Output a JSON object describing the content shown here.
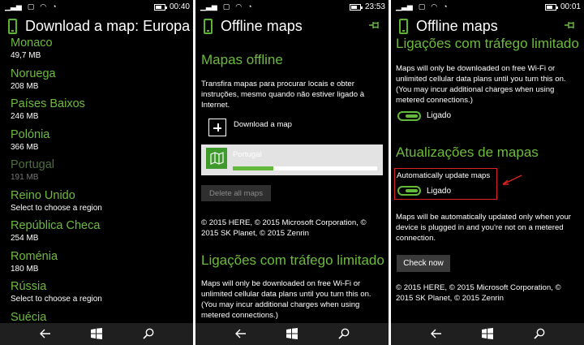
{
  "panels": [
    {
      "status_time": "00:40",
      "title": "Download a map: Europa",
      "countries": [
        {
          "name": "Monaco",
          "sub": "49,7 MB",
          "dim": false
        },
        {
          "name": "Noruega",
          "sub": "208 MB",
          "dim": false
        },
        {
          "name": "Países Baixos",
          "sub": "246 MB",
          "dim": false
        },
        {
          "name": "Polónia",
          "sub": "366 MB",
          "dim": false
        },
        {
          "name": "Portugal",
          "sub": "191 MB",
          "dim": true
        },
        {
          "name": "Reino Unido",
          "sub": "Select to choose a region",
          "dim": false
        },
        {
          "name": "República Checa",
          "sub": "254 MB",
          "dim": false
        },
        {
          "name": "Roménia",
          "sub": "180 MB",
          "dim": false
        },
        {
          "name": "Rússia",
          "sub": "Select to choose a region",
          "dim": false
        },
        {
          "name": "Suécia",
          "sub": "",
          "dim": false
        }
      ]
    },
    {
      "status_time": "23:53",
      "title": "Offline maps",
      "section1": "Mapas offline",
      "intro": "Transfira mapas para procurar locais e obter instruções, mesmo quando não estiver ligado à Internet.",
      "download_label": "Download a map",
      "downloading_name": "Portugal",
      "download_progress_pct": 28,
      "delete_label": "Delete all maps",
      "copyright": "© 2015 HERE, © 2015 Microsoft Corporation, © 2015 SK Planet, © 2015 Zenrin",
      "section2": "Ligações com tráfego limitado",
      "metered_text": "Maps will only be downloaded on free Wi-Fi or unlimited cellular data plans until you turn this on. (You may incur additional charges when using metered connections.)"
    },
    {
      "status_time": "00:01",
      "title": "Offline maps",
      "section_top": "Ligações com tráfego limitado",
      "metered_text": "Maps will only be downloaded on free Wi-Fi or unlimited cellular data plans until you turn this on. (You may incur additional charges when using metered connections.)",
      "metered_toggle_label": "Ligado",
      "metered_toggle_on": true,
      "section_updates": "Atualizações de mapas",
      "auto_update_label": "Automatically update maps",
      "auto_update_toggle_label": "Ligado",
      "auto_update_on": true,
      "auto_update_text": "Maps will be automatically updated only when your device is plugged in and you're not on a metered connection.",
      "check_now_label": "Check now",
      "copyright": "© 2015 HERE, © 2015 Microsoft Corporation, © 2015 SK Planet, © 2015 Zenrin"
    }
  ],
  "colors": {
    "accent": "#6dbb3c",
    "highlight_box": "#dd2222"
  }
}
